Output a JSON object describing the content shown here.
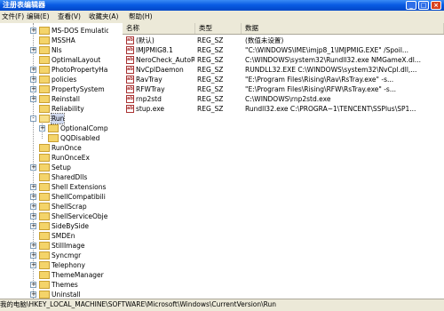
{
  "window": {
    "title": "注册表编辑器"
  },
  "menu": {
    "items": [
      "文件(F)",
      "编辑(E)",
      "查看(V)",
      "收藏夹(A)",
      "帮助(H)"
    ]
  },
  "tree": {
    "items": [
      {
        "label": "MS-DOS Emulation",
        "expander": "+"
      },
      {
        "label": "MSSHA",
        "expander": ""
      },
      {
        "label": "Nls",
        "expander": "+"
      },
      {
        "label": "OptimalLayout",
        "expander": ""
      },
      {
        "label": "PhotoPropertyHan",
        "expander": "+"
      },
      {
        "label": "policies",
        "expander": "+"
      },
      {
        "label": "PropertySystem",
        "expander": "+"
      },
      {
        "label": "Reinstall",
        "expander": "+"
      },
      {
        "label": "Reliability",
        "expander": ""
      },
      {
        "label": "Run",
        "expander": "-"
      },
      {
        "label": "OptionalCompo",
        "expander": "+"
      },
      {
        "label": "QQDisabled",
        "expander": ""
      },
      {
        "label": "RunOnce",
        "expander": ""
      },
      {
        "label": "RunOnceEx",
        "expander": ""
      },
      {
        "label": "Setup",
        "expander": "+"
      },
      {
        "label": "SharedDlls",
        "expander": ""
      },
      {
        "label": "Shell Extensions",
        "expander": "+"
      },
      {
        "label": "ShellCompatibili",
        "expander": "+"
      },
      {
        "label": "ShellScrap",
        "expander": "+"
      },
      {
        "label": "ShellServiceObje",
        "expander": "+"
      },
      {
        "label": "SideBySide",
        "expander": "+"
      },
      {
        "label": "SMDEn",
        "expander": ""
      },
      {
        "label": "StillImage",
        "expander": "+"
      },
      {
        "label": "Syncmgr",
        "expander": "+"
      },
      {
        "label": "Telephony",
        "expander": "+"
      },
      {
        "label": "ThemeManager",
        "expander": ""
      },
      {
        "label": "Themes",
        "expander": "+"
      },
      {
        "label": "Uninstall",
        "expander": "+"
      }
    ]
  },
  "list": {
    "columns": [
      "名称",
      "类型",
      "数据"
    ],
    "rows": [
      {
        "name": "(默认)",
        "type": "REG_SZ",
        "data": "(数值未设置)"
      },
      {
        "name": "IMJPMIG8.1",
        "type": "REG_SZ",
        "data": "\"C:\\WINDOWS\\IME\\imjp8_1\\IMJPMIG.EXE\" /Spoil..."
      },
      {
        "name": "NeroCheck_AutoRun",
        "type": "REG_SZ",
        "data": "C:\\WINDOWS\\system32\\Rundll32.exe NMGameX.dl..."
      },
      {
        "name": "NvCplDaemon",
        "type": "REG_SZ",
        "data": "RUNDLL32.EXE C:\\WINDOWS\\system32\\NvCpl.dll,..."
      },
      {
        "name": "RavTray",
        "type": "REG_SZ",
        "data": "\"E:\\Program Files\\Rising\\Rav\\RsTray.exe\" -s..."
      },
      {
        "name": "RFWTray",
        "type": "REG_SZ",
        "data": "\"E:\\Program Files\\Rising\\RFW\\RsTray.exe\" -s..."
      },
      {
        "name": "rnp2std",
        "type": "REG_SZ",
        "data": "C:\\WINDOWS\\rnp2std.exe"
      },
      {
        "name": "stup.exe",
        "type": "REG_SZ",
        "data": "Rundll32.exe C:\\PROGRA~1\\TENCENT\\SSPlus\\SP1..."
      }
    ]
  },
  "status": {
    "path": "我的电脑\\HKEY_LOCAL_MACHINE\\SOFTWARE\\Microsoft\\Windows\\CurrentVersion\\Run"
  },
  "colors": {
    "titlebar": "#0a5ce4",
    "menubar": "#ece9d8",
    "folder": "#f4d46a"
  }
}
